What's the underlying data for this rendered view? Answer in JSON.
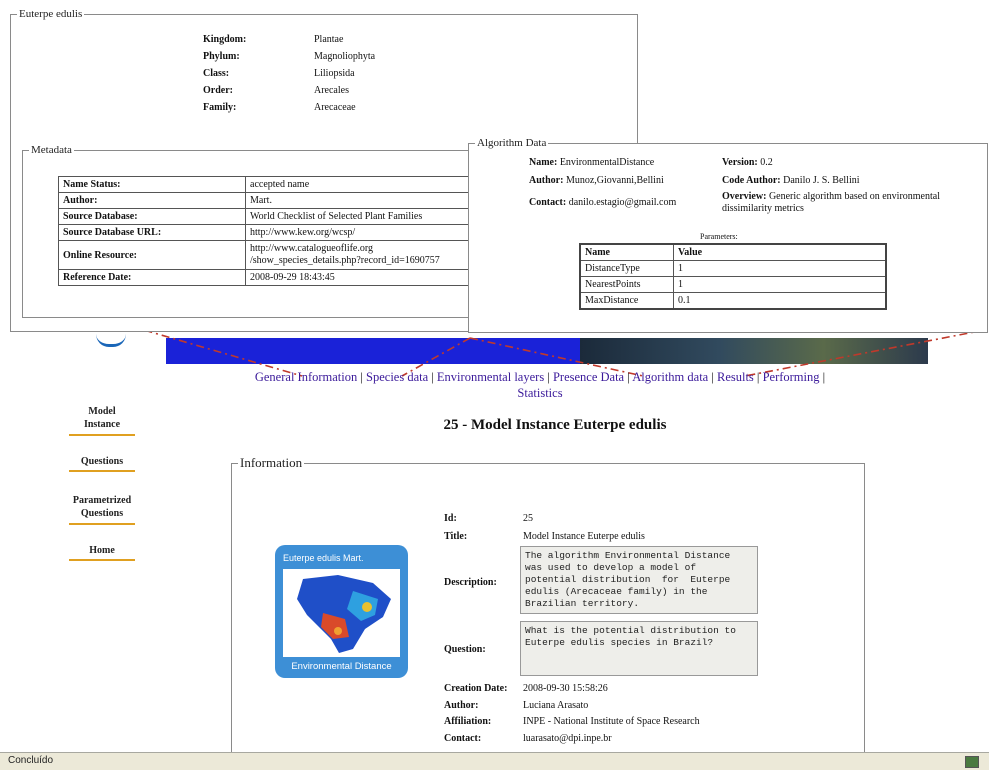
{
  "species_box": {
    "legend": "Euterpe edulis",
    "taxonomy": [
      {
        "label": "Kingdom:",
        "value": "Plantae"
      },
      {
        "label": "Phylum:",
        "value": "Magnoliophyta"
      },
      {
        "label": "Class:",
        "value": "Liliopsida"
      },
      {
        "label": "Order:",
        "value": "Arecales"
      },
      {
        "label": "Family:",
        "value": "Arecaceae"
      }
    ]
  },
  "metadata_box": {
    "legend": "Metadata",
    "rows": [
      {
        "label": "Name Status:",
        "value": "accepted name"
      },
      {
        "label": "Author:",
        "value": "Mart."
      },
      {
        "label": "Source Database:",
        "value": "World Checklist of Selected Plant Families"
      },
      {
        "label": "Source Database URL:",
        "value": "http://www.kew.org/wcsp/"
      },
      {
        "label": "Online Resource:",
        "value": "http://www.catalogueoflife.org\n/show_species_details.php?record_id=1690757"
      },
      {
        "label": "Reference Date:",
        "value": "2008-09-29 18:43:45"
      }
    ]
  },
  "algorithm_box": {
    "legend": "Algorithm Data",
    "name_label": "Name:",
    "name_value": "EnvironmentalDistance",
    "author_label": "Author:",
    "author_value": "Munoz,Giovanni,Bellini",
    "contact_label": "Contact:",
    "contact_value": "danilo.estagio@gmail.com",
    "version_label": "Version:",
    "version_value": "0.2",
    "code_author_label": "Code Author:",
    "code_author_value": "Danilo J. S. Bellini",
    "overview_label": "Overview:",
    "overview_value": "Generic algorithm based on environmental dissimilarity metrics",
    "params_title": "Parameters:",
    "params_headers": [
      "Name",
      "Value"
    ],
    "params": [
      {
        "name": "DistanceType",
        "value": "1"
      },
      {
        "name": "NearestPoints",
        "value": "1"
      },
      {
        "name": "MaxDistance",
        "value": "0.1"
      }
    ]
  },
  "nav": {
    "items": [
      "General Information",
      "Species data",
      "Environmental layers",
      "Presence Data",
      "Algorithm data",
      "Results",
      "Performing"
    ],
    "separator": "|",
    "second_line": "Statistics"
  },
  "sidebar": {
    "items": [
      "Model\nInstance",
      "Questions",
      "Parametrized\nQuestions",
      "Home"
    ]
  },
  "page_title": "25 - Model Instance Euterpe edulis",
  "info_box": {
    "legend": "Information",
    "thumbnail_top": "Euterpe edulis Mart.",
    "thumbnail_bottom": "Environmental Distance",
    "fields": {
      "id_label": "Id:",
      "id_value": "25",
      "title_label": "Title:",
      "title_value": "Model Instance Euterpe edulis",
      "description_label": "Description:",
      "description_value": "The algorithm Environmental Distance was used to develop a model of potential distribution  for  Euterpe edulis (Arecaceae family) in the Brazilian territory.",
      "question_label": "Question:",
      "question_value": "What is the potential distribution to Euterpe edulis species in Brazil?",
      "creation_label": "Creation Date:",
      "creation_value": "2008-09-30 15:58:26",
      "author_label": "Author:",
      "author_value": "Luciana Arasato",
      "affiliation_label": "Affiliation:",
      "affiliation_value": "INPE - National Institute of Space Research",
      "contact_label": "Contact:",
      "contact_value": "luarasato@dpi.inpe.br"
    }
  },
  "status_bar": {
    "text": "Concluído"
  },
  "colors": {
    "accent_bar": "#e0a020",
    "nav_link": "#3b1a9a",
    "banner": "#1a22d8",
    "connector": "#c0392b",
    "thumb_bg": "#3d8fd6"
  }
}
